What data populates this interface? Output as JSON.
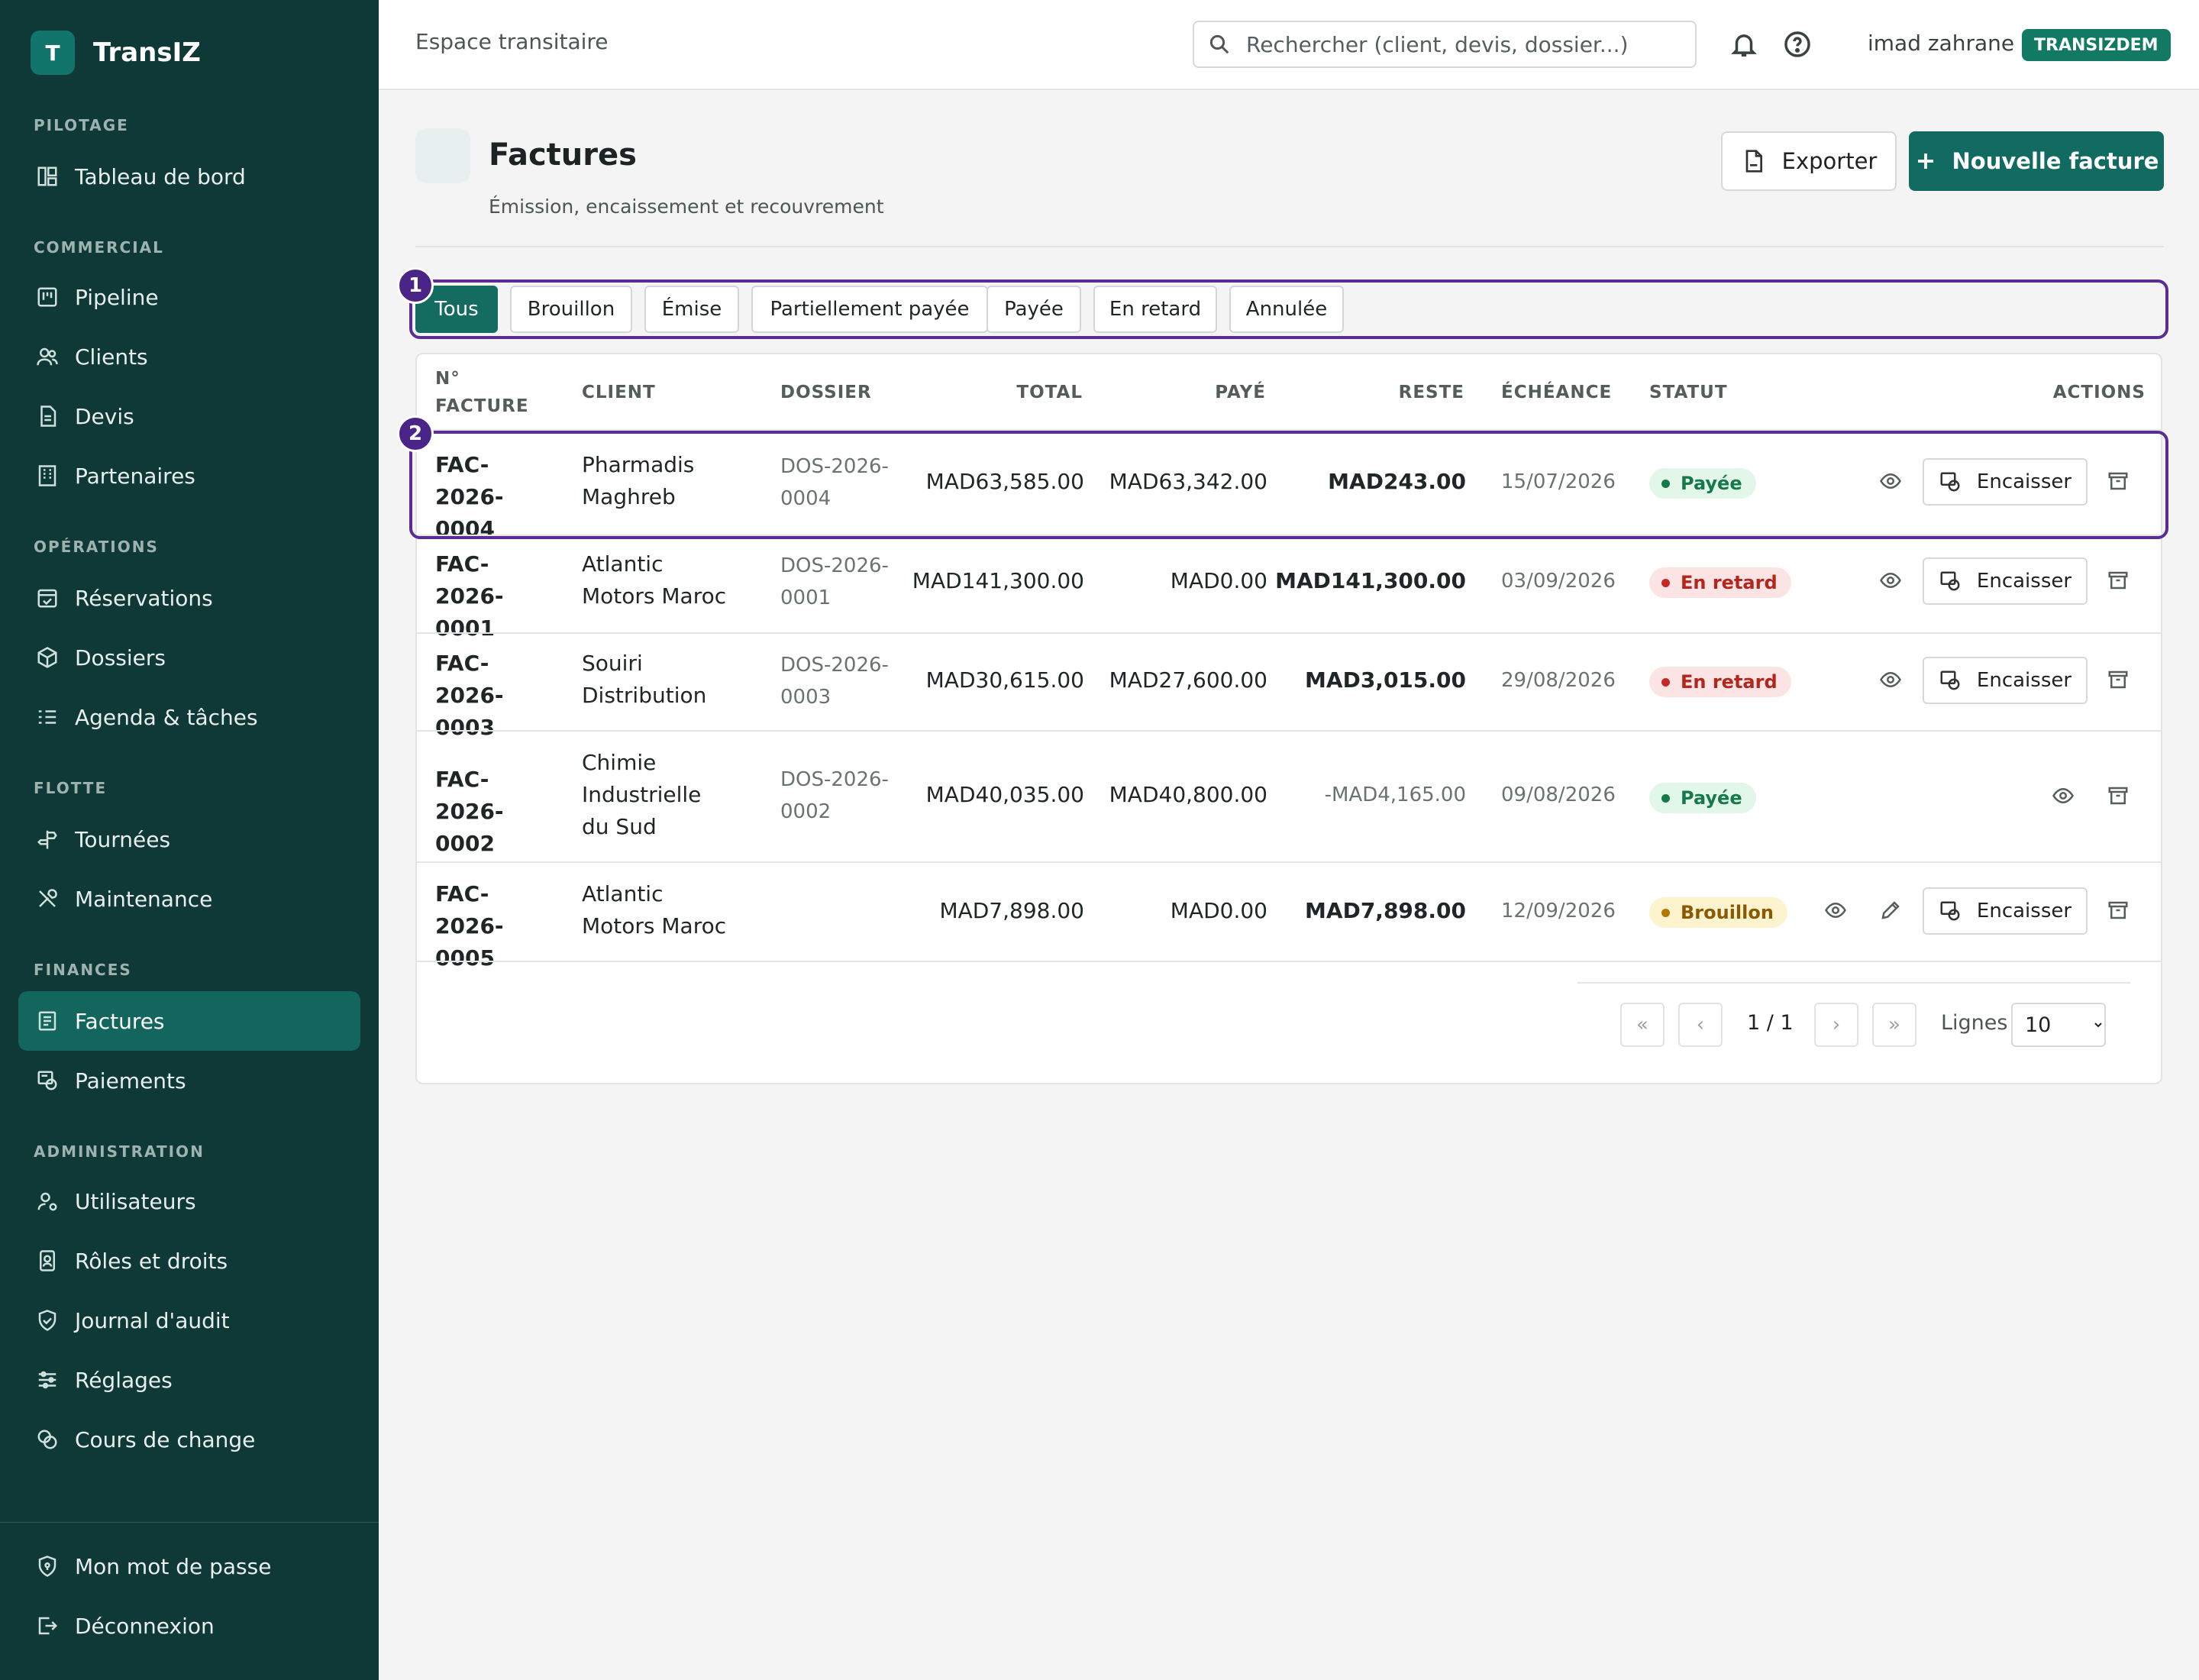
{
  "brand": {
    "logo_letter": "T",
    "name": "TransIZ"
  },
  "sidebar": {
    "sections": {
      "pilotage": "PILOTAGE",
      "commercial": "COMMERCIAL",
      "operations": "OPÉRATIONS",
      "flotte": "FLOTTE",
      "finances": "FINANCES",
      "administration": "ADMINISTRATION"
    },
    "items": {
      "tableau": "Tableau de bord",
      "pipeline": "Pipeline",
      "clients": "Clients",
      "devis": "Devis",
      "partenaires": "Partenaires",
      "reservations": "Réservations",
      "dossiers": "Dossiers",
      "agenda": "Agenda & tâches",
      "tournees": "Tournées",
      "maintenance": "Maintenance",
      "factures": "Factures",
      "paiements": "Paiements",
      "utilisateurs": "Utilisateurs",
      "roles": "Rôles et droits",
      "journal": "Journal d'audit",
      "reglages": "Réglages",
      "cours": "Cours de change",
      "motdepasse": "Mon mot de passe",
      "deconnexion": "Déconnexion"
    }
  },
  "topbar": {
    "title": "Espace transitaire",
    "search_placeholder": "Rechercher (client, devis, dossier...)",
    "user": "imad zahrane",
    "org": "TRANSIZDEM"
  },
  "page": {
    "title": "Factures",
    "subtitle": "Émission, encaissement et recouvrement",
    "export_label": "Exporter",
    "new_label": "Nouvelle facture"
  },
  "filters": [
    "Tous",
    "Brouillon",
    "Émise",
    "Partiellement payée",
    "Payée",
    "En retard",
    "Annulée"
  ],
  "markers": [
    "1",
    "2"
  ],
  "table": {
    "headers": {
      "numero": "N° FACTURE",
      "client": "CLIENT",
      "dossier": "DOSSIER",
      "total": "TOTAL",
      "paye": "PAYÉ",
      "reste": "RESTE",
      "echeance": "ÉCHÉANCE",
      "statut": "STATUT",
      "actions": "ACTIONS"
    },
    "encaisser_label": "Encaisser",
    "rows": [
      {
        "numero": "FAC-2026-0004",
        "client": "Pharmadis Maghreb",
        "dossier": "DOS-2026-0004",
        "total": "MAD63,585.00",
        "paye": "MAD63,342.00",
        "reste": "MAD243.00",
        "echeance": "15/07/2026",
        "statut": "Payée"
      },
      {
        "numero": "FAC-2026-0001",
        "client": "Atlantic Motors Maroc",
        "dossier": "DOS-2026-0001",
        "total": "MAD141,300.00",
        "paye": "MAD0.00",
        "reste": "MAD141,300.00",
        "echeance": "03/09/2026",
        "statut": "En retard"
      },
      {
        "numero": "FAC-2026-0003",
        "client": "Souiri Distribution",
        "dossier": "DOS-2026-0003",
        "total": "MAD30,615.00",
        "paye": "MAD27,600.00",
        "reste": "MAD3,015.00",
        "echeance": "29/08/2026",
        "statut": "En retard"
      },
      {
        "numero": "FAC-2026-0002",
        "client": "Chimie Industrielle du Sud",
        "dossier": "DOS-2026-0002",
        "total": "MAD40,035.00",
        "paye": "MAD40,800.00",
        "reste": "-MAD4,165.00",
        "echeance": "09/08/2026",
        "statut": "Payée"
      },
      {
        "numero": "FAC-2026-0005",
        "client": "Atlantic Motors Maroc",
        "dossier": "",
        "total": "MAD7,898.00",
        "paye": "MAD0.00",
        "reste": "MAD7,898.00",
        "echeance": "12/09/2026",
        "statut": "Brouillon"
      }
    ]
  },
  "pagination": {
    "first": "«",
    "prev": "‹",
    "page_info": "1 / 1",
    "next": "›",
    "last": "»",
    "rows_label": "Lignes",
    "rows_value": "10"
  },
  "colors": {
    "sidebar_bg": "#0f3936",
    "accent": "#116b61",
    "highlight": "#5b2d91"
  }
}
